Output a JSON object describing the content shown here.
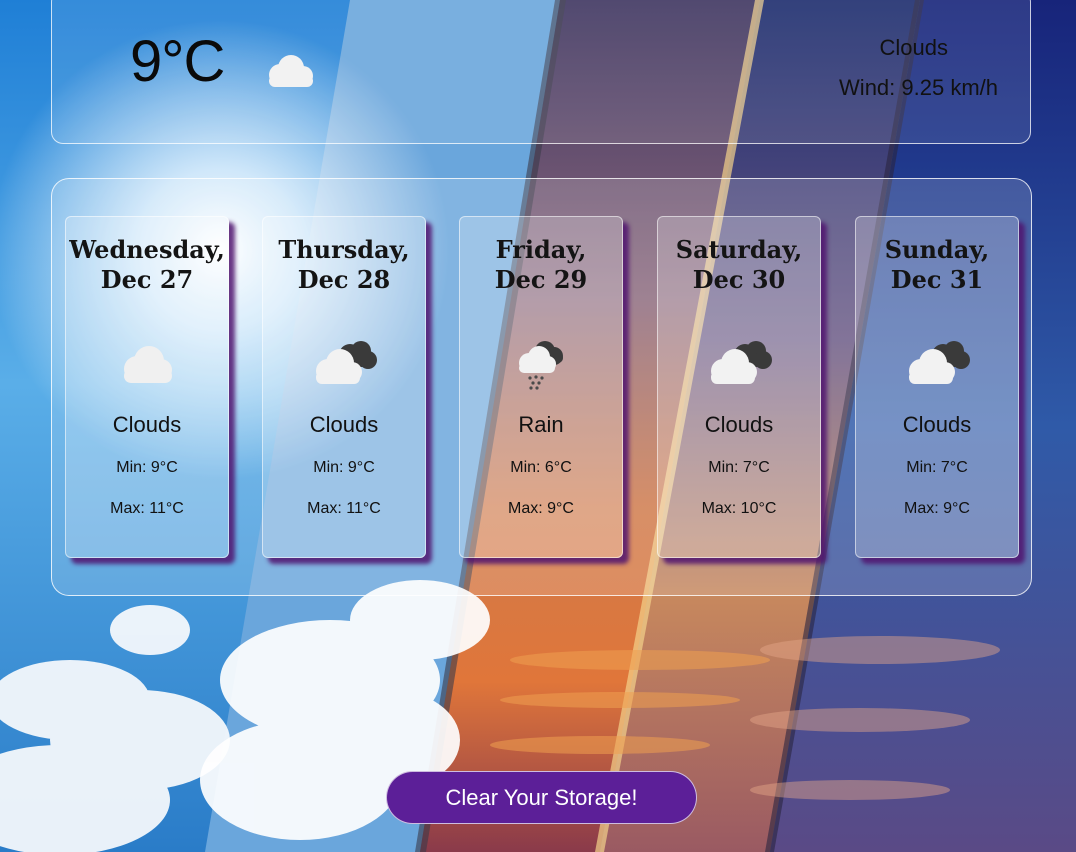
{
  "current": {
    "temperature": "9°C",
    "icon": "cloud-icon",
    "condition": "Clouds",
    "wind": "Wind: 9.25 km/h"
  },
  "forecast": [
    {
      "day": "Wednesday,",
      "date": "Dec 27",
      "icon": "cloud-icon",
      "condition": "Clouds",
      "min": "Min: 9°C",
      "max": "Max: 11°C"
    },
    {
      "day": "Thursday,",
      "date": "Dec 28",
      "icon": "dark-clouds-icon",
      "condition": "Clouds",
      "min": "Min: 9°C",
      "max": "Max: 11°C"
    },
    {
      "day": "Friday,",
      "date": "Dec 29",
      "icon": "rain-cloud-icon",
      "condition": "Rain",
      "min": "Min: 6°C",
      "max": "Max: 9°C"
    },
    {
      "day": "Saturday,",
      "date": "Dec 30",
      "icon": "dark-clouds-icon",
      "condition": "Clouds",
      "min": "Min: 7°C",
      "max": "Max: 10°C"
    },
    {
      "day": "Sunday,",
      "date": "Dec 31",
      "icon": "dark-clouds-icon",
      "condition": "Clouds",
      "min": "Min: 7°C",
      "max": "Max: 9°C"
    }
  ],
  "actions": {
    "clear_label": "Clear Your Storage!"
  },
  "colors": {
    "button": "#5c1f98",
    "card_shadow": "#50146e"
  }
}
